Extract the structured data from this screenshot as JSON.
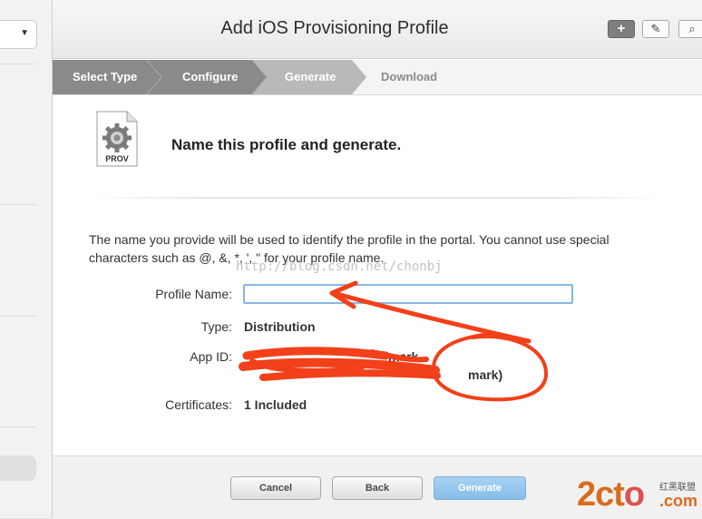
{
  "window": {
    "title": "Add iOS Provisioning Profile"
  },
  "toolbar": {
    "add_icon": "+",
    "edit_icon": "✎",
    "search_icon": "⌕"
  },
  "steps": [
    {
      "label": "Select Type",
      "state": "done"
    },
    {
      "label": "Configure",
      "state": "done"
    },
    {
      "label": "Generate",
      "state": "current"
    },
    {
      "label": "Download",
      "state": "pending"
    }
  ],
  "profile_icon": {
    "label": "PROV",
    "icon": "gear-document-icon"
  },
  "heading": "Name this profile and generate.",
  "description": "The name you provide will be used to identify the profile in the portal. You cannot use special characters such as @, &, *, ', \" for your profile name.",
  "watermark": "http://blog.csdn.net/chonbj",
  "form": {
    "profile_name_label": "Profile Name:",
    "profile_name_value": "",
    "type_label": "Type:",
    "type_value": "Distribution",
    "app_id_label": "App ID:",
    "app_id_line1": "mark",
    "app_id_line2": "mark)",
    "certificates_label": "Certificates:",
    "certificates_value": "1 Included"
  },
  "footer": {
    "cancel": "Cancel",
    "back": "Back",
    "generate": "Generate"
  },
  "logo": {
    "main_a": "2ct",
    "main_o": "o",
    "small": "红黑联盟",
    "dotcom": ".com"
  },
  "colors": {
    "annotation": "#f2401a",
    "step_done": "#8a8a8a",
    "step_current": "#b9b9b9",
    "generate_button": "#8fc1ea"
  }
}
